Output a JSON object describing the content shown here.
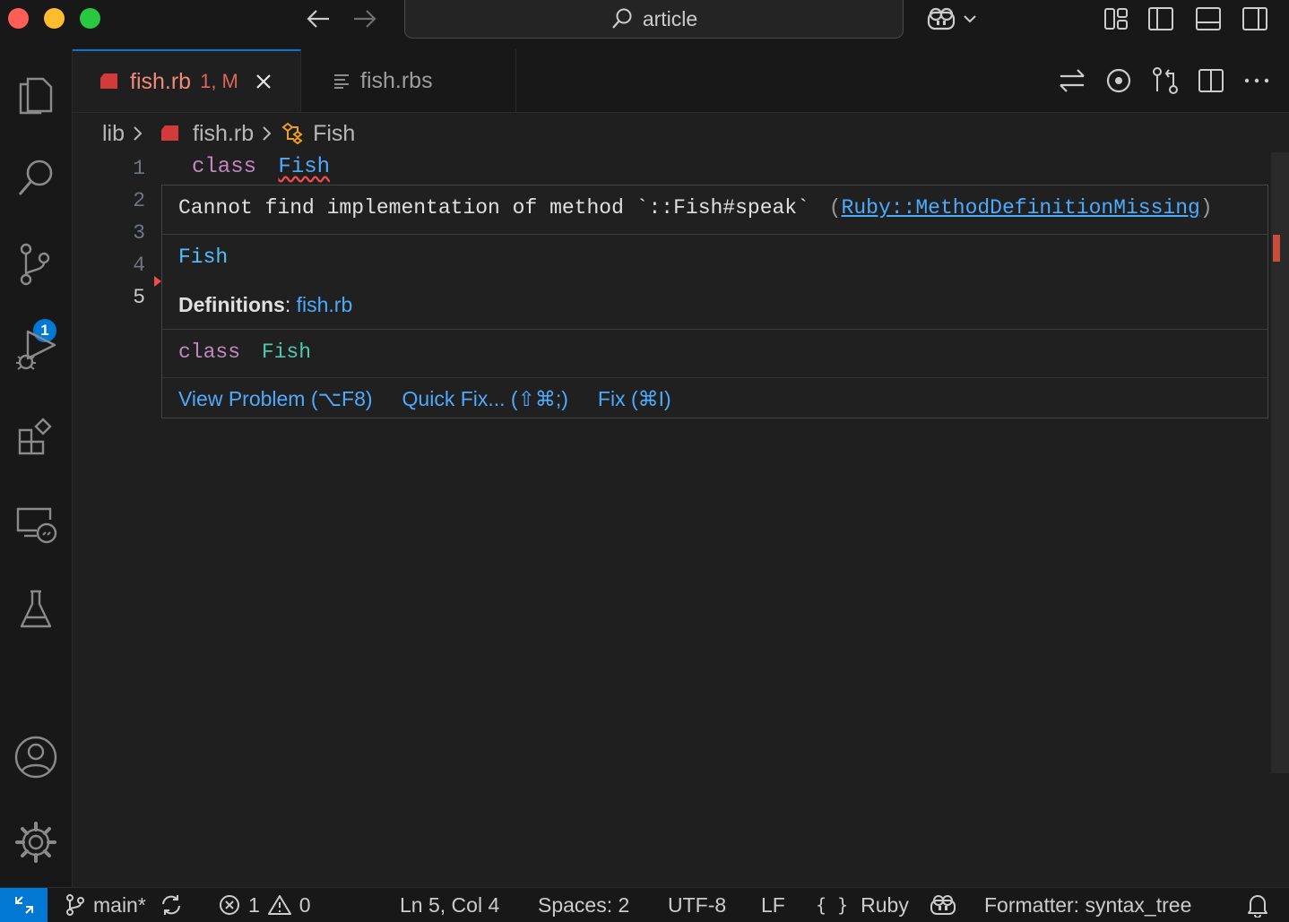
{
  "window": {
    "search_text": "article"
  },
  "tabs": [
    {
      "name": "fish.rb",
      "status": "1, M",
      "accent": "#e05555"
    },
    {
      "name": "fish.rbs"
    }
  ],
  "breadcrumb": {
    "folder": "lib",
    "file": "fish.rb",
    "symbol": "Fish"
  },
  "editor": {
    "line_numbers": [
      "1",
      "2",
      "3",
      "4",
      "5"
    ],
    "line1_keyword": "class",
    "line1_name": "Fish"
  },
  "hover": {
    "message": "Cannot find implementation of method `::Fish#speak`",
    "code_open": "(",
    "code_link": "Ruby::MethodDefinitionMissing",
    "code_close": ")",
    "symbol": "Fish",
    "definitions_label": "Definitions",
    "definitions_sep": ": ",
    "definitions_link": "fish.rb",
    "signature_keyword": "class",
    "signature_name": "Fish",
    "actions": [
      "View Problem (⌥F8)",
      "Quick Fix... (⇧⌘;)",
      "Fix (⌘I)"
    ]
  },
  "activity_bar": {
    "scm_badge": "1",
    "icons": [
      "explorer-icon",
      "search-icon",
      "source-control-icon",
      "run-debug-icon",
      "extensions-icon",
      "remote-explorer-icon",
      "testing-icon",
      "account-icon",
      "manage-gear-icon"
    ]
  },
  "status_bar": {
    "branch": "main*",
    "errors": "1",
    "warnings": "0",
    "position": "Ln 5, Col 4",
    "spaces": "Spaces: 2",
    "encoding": "UTF-8",
    "eol": "LF",
    "language": "Ruby",
    "formatter": "Formatter: syntax_tree"
  },
  "colors": {
    "accent": "#0078d4",
    "keyword": "#c586c0",
    "type": "#4ec9b0",
    "link": "#4daafc",
    "error": "#f14c4c"
  }
}
